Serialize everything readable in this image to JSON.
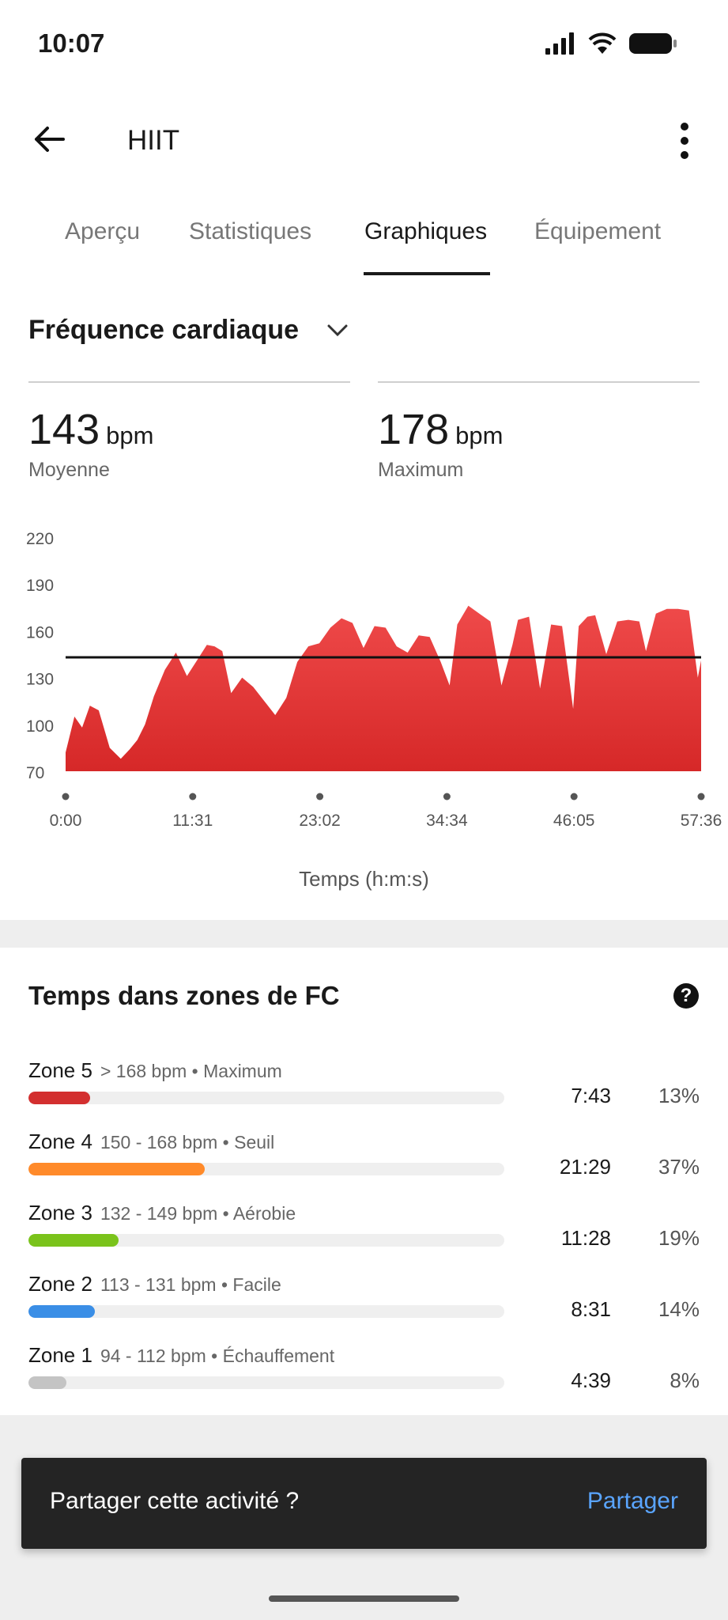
{
  "status_bar": {
    "time": "10:07"
  },
  "header": {
    "title": "HIIT"
  },
  "tabs": [
    {
      "label": "Aperçu",
      "active": false
    },
    {
      "label": "Statistiques",
      "active": false
    },
    {
      "label": "Graphiques",
      "active": true
    },
    {
      "label": "Équipement",
      "active": false
    }
  ],
  "metric": {
    "selected": "Fréquence cardiaque",
    "stats": [
      {
        "value": "143",
        "unit": "bpm",
        "label": "Moyenne"
      },
      {
        "value": "178",
        "unit": "bpm",
        "label": "Maximum"
      }
    ]
  },
  "chart_data": {
    "type": "area",
    "xlabel": "Temps (h:m:s)",
    "ylabel": "",
    "x_ticks": [
      "0:00",
      "11:31",
      "23:02",
      "34:34",
      "46:05",
      "57:36"
    ],
    "y_ticks": [
      220,
      190,
      160,
      130,
      100,
      70
    ],
    "ylim": [
      70,
      220
    ],
    "xlim_minutes": [
      0,
      57.6
    ],
    "average_line": 143,
    "fill_color": "#e53935",
    "series": [
      {
        "x_minutes": [
          0,
          0.8,
          1.5,
          2.2,
          3.0,
          4.0,
          5.0,
          5.8,
          6.5,
          7.2,
          8.0,
          9.0,
          10.0,
          11.0,
          12.0,
          12.8,
          13.5,
          14.2,
          15.0,
          16.0,
          17.0,
          18.0,
          19.0,
          20.0,
          21.0,
          22.0,
          23.0,
          24.0,
          25.0,
          26.0,
          27.0,
          28.0,
          29.0,
          30.0,
          31.0,
          32.0,
          33.0,
          34.0,
          34.8,
          35.5,
          36.5,
          37.5,
          38.5,
          39.5,
          40.5,
          41.0,
          42.0,
          43.0,
          44.0,
          45.0,
          46.0,
          46.5,
          47.3,
          48.0,
          49.0,
          50.0,
          51.0,
          52.0,
          52.6,
          53.5,
          54.5,
          55.5,
          56.5,
          57.3,
          57.6
        ],
        "values": [
          82,
          105,
          98,
          112,
          109,
          85,
          78,
          84,
          90,
          100,
          118,
          135,
          146,
          131,
          142,
          151,
          150,
          147,
          120,
          130,
          124,
          115,
          106,
          117,
          140,
          150,
          152,
          162,
          168,
          165,
          149,
          163,
          162,
          150,
          146,
          157,
          156,
          140,
          125,
          164,
          176,
          171,
          166,
          125,
          151,
          167,
          169,
          123,
          164,
          163,
          110,
          163,
          169,
          170,
          145,
          166,
          167,
          166,
          147,
          171,
          174,
          174,
          173,
          130,
          141
        ]
      }
    ]
  },
  "zones": {
    "title": "Temps dans zones de FC",
    "items": [
      {
        "name": "Zone 5",
        "desc": "> 168 bpm • Maximum",
        "time": "7:43",
        "pct": "13%",
        "fraction": 0.13,
        "color": "#d32f2f"
      },
      {
        "name": "Zone 4",
        "desc": "150 - 168 bpm • Seuil",
        "time": "21:29",
        "pct": "37%",
        "fraction": 0.37,
        "color": "#ff8a2a"
      },
      {
        "name": "Zone 3",
        "desc": "132 - 149 bpm • Aérobie",
        "time": "11:28",
        "pct": "19%",
        "fraction": 0.19,
        "color": "#7ac31b"
      },
      {
        "name": "Zone 2",
        "desc": "113 - 131 bpm • Facile",
        "time": "8:31",
        "pct": "14%",
        "fraction": 0.14,
        "color": "#3a8ee6"
      },
      {
        "name": "Zone 1",
        "desc": "94 - 112 bpm • Échauffement",
        "time": "4:39",
        "pct": "8%",
        "fraction": 0.08,
        "color": "#c4c4c4"
      }
    ]
  },
  "snackbar": {
    "text": "Partager cette activité ?",
    "action": "Partager"
  }
}
